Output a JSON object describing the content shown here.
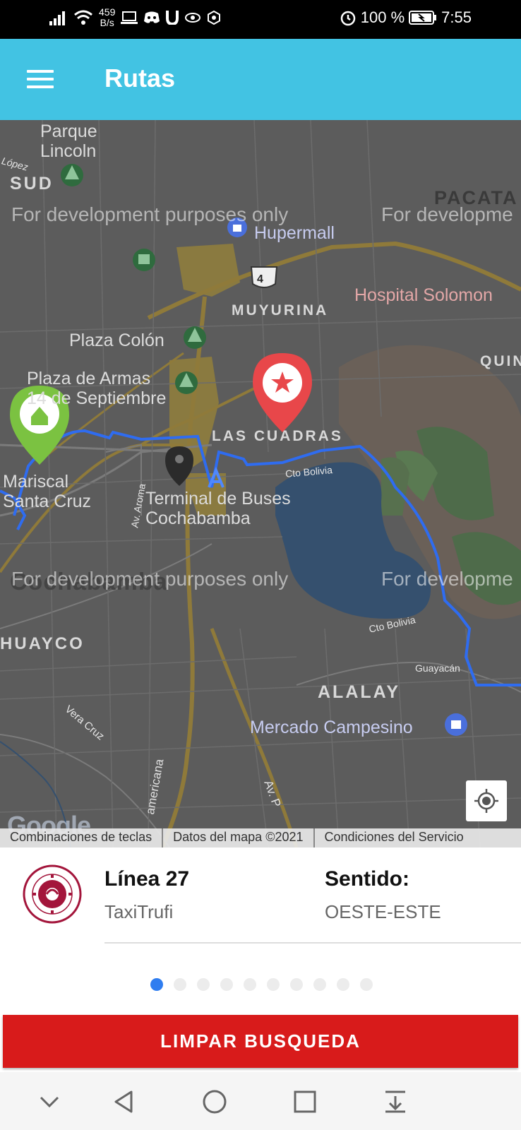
{
  "status_bar": {
    "net_speed_value": "459",
    "net_speed_unit": "B/s",
    "battery": "100 %",
    "time": "7:55",
    "icons": [
      "signal-icon",
      "wifi-icon",
      "laptop-icon",
      "discord-icon",
      "u-app-icon",
      "eye-icon",
      "hex-icon",
      "alarm-icon",
      "battery-icon"
    ]
  },
  "app_bar": {
    "title": "Rutas",
    "color": "#42c3e3"
  },
  "map": {
    "labels": {
      "parque": "Parque\nLincoln",
      "lopez": "López",
      "sud": "SUD",
      "pacata": "PACATA",
      "hupermall": "Hupermall",
      "highway": "4",
      "hospital": "Hospital Solomon",
      "muyurina": "MUYURINA",
      "quin": "QUIN",
      "plaza_colon": "Plaza Colón",
      "plaza_armas": "Plaza de Armas\n14 de Septiembre",
      "las_cuadras": "LAS CUADRAS",
      "cto_bolivia_1": "Cto Bolivia",
      "mariscal": "Mariscal\nSanta Cruz",
      "av_aroma": "Av. Aroma",
      "terminal": "Terminal de Buses\nCochabamba",
      "cochabamba": "Cochabamba",
      "huayco": "HUAYCO",
      "cto_bolivia_2": "Cto Bolivia",
      "guayacan": "Guayacán",
      "alalay": "ALALAY",
      "vera_cruz": "Vera Cruz",
      "mercado": "Mercado Campesino",
      "americana": "americana",
      "av_p": "Av. P",
      "google": "Google"
    },
    "watermarks": [
      "For development purposes only",
      "For developme",
      "For development purposes only",
      "For developme"
    ],
    "attribution": [
      "Combinaciones de teclas",
      "Datos del mapa ©2021",
      "Condiciones del Servicio"
    ],
    "route_color": "#2f6cf0"
  },
  "route_card": {
    "line_title": "Línea 27",
    "line_subtitle": "TaxiTrufi",
    "direction_title": "Sentido:",
    "direction_value": "OESTE-ESTE",
    "logo_text_top": "UNIVERSIDAD DEL VALLE",
    "logo_text_bottom": "BOLIVIA",
    "page_count": 10,
    "active_page": 1
  },
  "clear_button": {
    "label": "LIMPAR BUSQUEDA",
    "color": "#d81b1b"
  },
  "nav_bar": {
    "icons": [
      "chevron-down-icon",
      "back-icon",
      "home-icon",
      "recents-icon",
      "notification-pull-icon"
    ]
  }
}
